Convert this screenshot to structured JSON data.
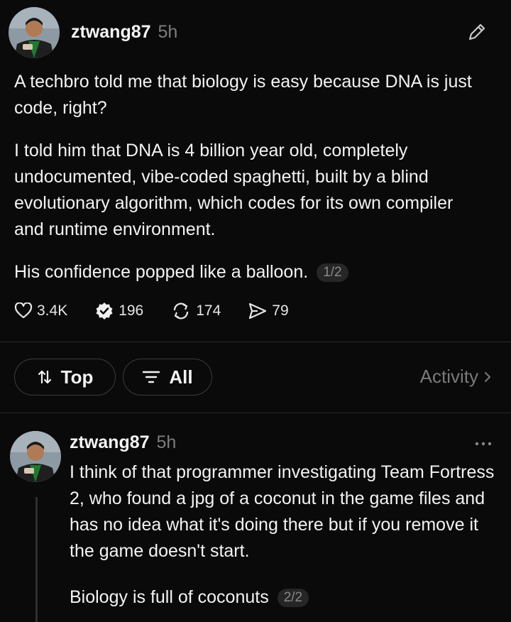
{
  "post": {
    "username": "ztwang87",
    "timestamp": "5h",
    "paragraph1": "A techbro told me that biology is easy because DNA is just code, right?",
    "paragraph2": "I told him that DNA is 4 billion year old, completely undocumented, vibe-coded spaghetti, built by a blind evolutionary algorithm, which codes for its own compiler and runtime environment.",
    "paragraph3": "His confidence popped like a balloon.",
    "page_badge": "1/2",
    "stats": {
      "likes": "3.4K",
      "replies": "196",
      "reposts": "174",
      "shares": "79"
    }
  },
  "filters": {
    "top_label": "Top",
    "all_label": "All",
    "activity_label": "Activity"
  },
  "reply": {
    "username": "ztwang87",
    "timestamp": "5h",
    "paragraph1": "I think of that programmer investigating Team Fortress 2, who found a jpg of a coconut in the game files and has no idea what it's doing there but if you remove it the game doesn't start.",
    "paragraph2": "Biology is full of coconuts",
    "page_badge": "2/2"
  },
  "icons": {
    "edit": "pencil-icon",
    "like": "heart-icon",
    "reply": "verified-badge-icon",
    "repost": "repost-icon",
    "share": "send-icon",
    "sort": "sort-arrows-icon",
    "filter": "filter-lines-icon",
    "more": "more-dots-icon",
    "chevron": "chevron-right-icon"
  },
  "colors": {
    "background": "#0a0a0a",
    "text": "#f3f3f3",
    "muted": "#7d7d7d",
    "divider": "#2a2a2a"
  }
}
